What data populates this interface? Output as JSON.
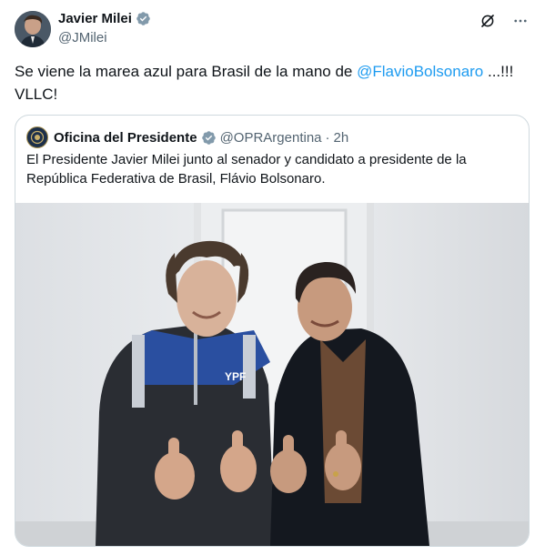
{
  "author": {
    "name": "Javier Milei",
    "handle": "@JMilei"
  },
  "tweet": {
    "text_before": "Se viene la marea azul para Brasil de la mano de ",
    "mention": "@FlavioBolsonaro",
    "text_after": " ...!!! VLLC!"
  },
  "quote": {
    "name": "Oficina del Presidente",
    "handle": "@OPRArgentina",
    "separator": "·",
    "time": "2h",
    "text": "El Presidente Javier Milei junto al senador y candidato a presidente de la República Federativa de Brasil, Flávio Bolsonaro.",
    "photo_jacket_text": "YPF"
  },
  "colors": {
    "accent": "#1d9bf0",
    "secondary_text": "#536471",
    "border": "#cfd9de"
  },
  "icons": [
    "grok-icon",
    "more-icon",
    "verified-icon"
  ]
}
